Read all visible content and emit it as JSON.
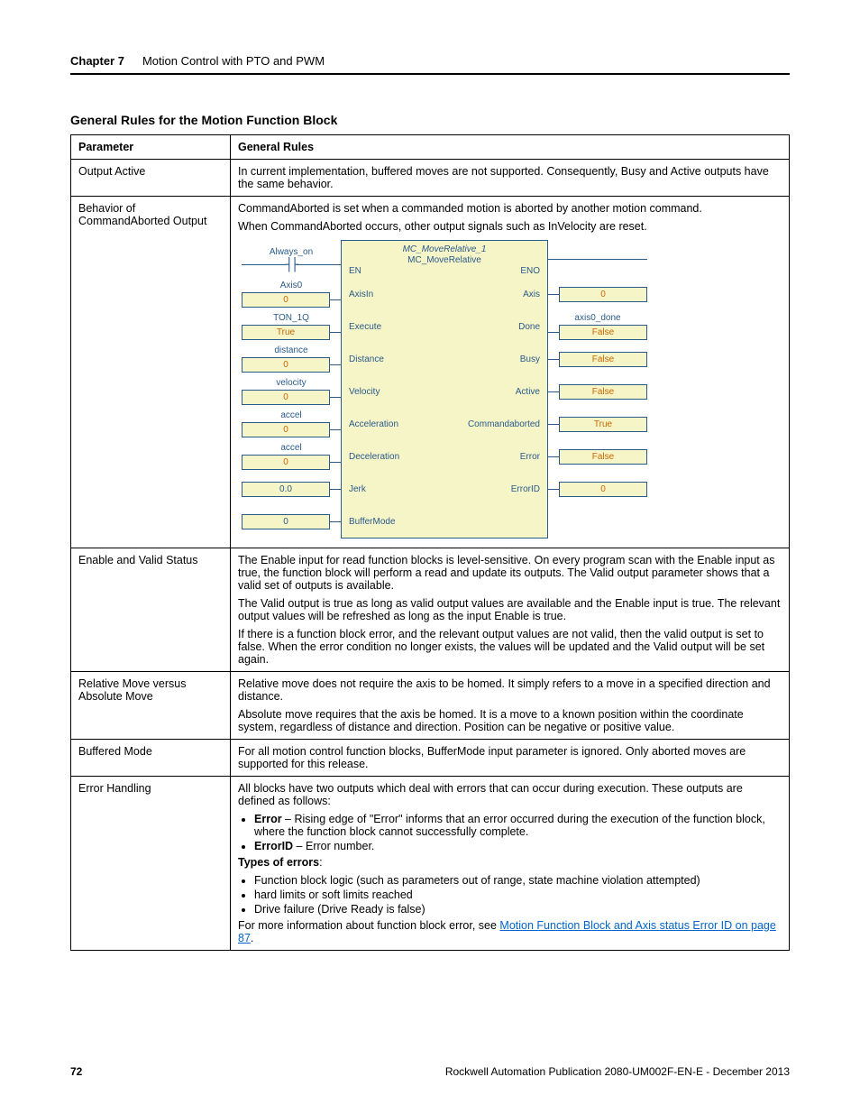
{
  "header": {
    "chapter": "Chapter 7",
    "title": "Motion Control with PTO and PWM"
  },
  "section_title": "General Rules for the Motion Function Block",
  "table": {
    "head_param": "Parameter",
    "head_rules": "General Rules",
    "rows": {
      "output_active": {
        "param": "Output Active",
        "text": "In current implementation, buffered moves are not supported. Consequently, Busy and Active outputs have the same behavior."
      },
      "cmd_aborted": {
        "param": "Behavior of CommandAborted Output",
        "p1": "CommandAborted is set when a commanded motion is aborted by another motion command.",
        "p2": "When CommandAborted occurs, other output signals such as InVelocity are reset."
      },
      "enable_valid": {
        "param": "Enable and Valid Status",
        "p1": "The Enable input for read function blocks is level-sensitive. On every program scan with the Enable input as true, the function block will perform a read and update its outputs. The Valid output parameter shows that a valid set of outputs is available.",
        "p2": "The Valid output is true as long as valid output values are available and the Enable input is true. The relevant output values will be refreshed as long as the input Enable is true.",
        "p3": "If there is a function block error, and the relevant output values are not valid, then the valid output is set to false. When the error condition no longer exists, the values will be updated and the Valid output will be set again."
      },
      "rel_abs": {
        "param": "Relative Move versus Absolute Move",
        "p1": "Relative move does not require the axis to be homed. It simply refers to a move in a specified direction and distance.",
        "p2": "Absolute move requires that the axis be homed. It is a move to a known position within the coordinate system, regardless of distance and direction. Position can be negative or positive value."
      },
      "buffered": {
        "param": "Buffered Mode",
        "text": "For all motion control function blocks, BufferMode input parameter is ignored. Only aborted moves are supported for this release."
      },
      "error_handling": {
        "param": "Error Handling",
        "intro": "All blocks have two outputs which deal with errors that can occur during execution. These outputs are defined as follows:",
        "b1_label": "Error",
        "b1_text": " – Rising edge of \"Error\" informs that an error occurred during the execution of the function block, where the function block cannot successfully complete.",
        "b2_label": "ErrorID",
        "b2_text": " – Error number.",
        "types_label": "Types of errors",
        "t1": "Function block logic (such as parameters out of range, state machine violation attempted)",
        "t2": "hard limits or soft limits reached",
        "t3": "Drive failure (Drive Ready is false)",
        "more_pre": "For more information about function block error, see ",
        "more_link": "Motion Function Block and Axis status Error ID on page 87",
        "more_post": "."
      }
    }
  },
  "fb": {
    "always_on": "Always_on",
    "title": "MC_MoveRelative_1",
    "subtitle": "MC_MoveRelative",
    "en": "EN",
    "eno": "ENO",
    "axis0": "Axis0",
    "zero": "0",
    "axisin": "AxisIn",
    "axis": "Axis",
    "ton": "TON_1Q",
    "true": "True",
    "execute": "Execute",
    "done": "Done",
    "axis0_done": "axis0_done",
    "false": "False",
    "distance_lbl": "distance",
    "distance": "Distance",
    "busy": "Busy",
    "velocity_lbl": "velocity",
    "velocity": "Velocity",
    "active": "Active",
    "accel_lbl": "accel",
    "acceleration": "Acceleration",
    "commandaborted": "Commandaborted",
    "true_out": "True",
    "deceleration": "Deceleration",
    "error": "Error",
    "zerozero": "0.0",
    "jerk": "Jerk",
    "errorid": "ErrorID",
    "zero_blue": "0",
    "buffermode": "BufferMode"
  },
  "footer": {
    "page": "72",
    "pub": "Rockwell Automation Publication 2080-UM002F-EN-E - December 2013"
  }
}
